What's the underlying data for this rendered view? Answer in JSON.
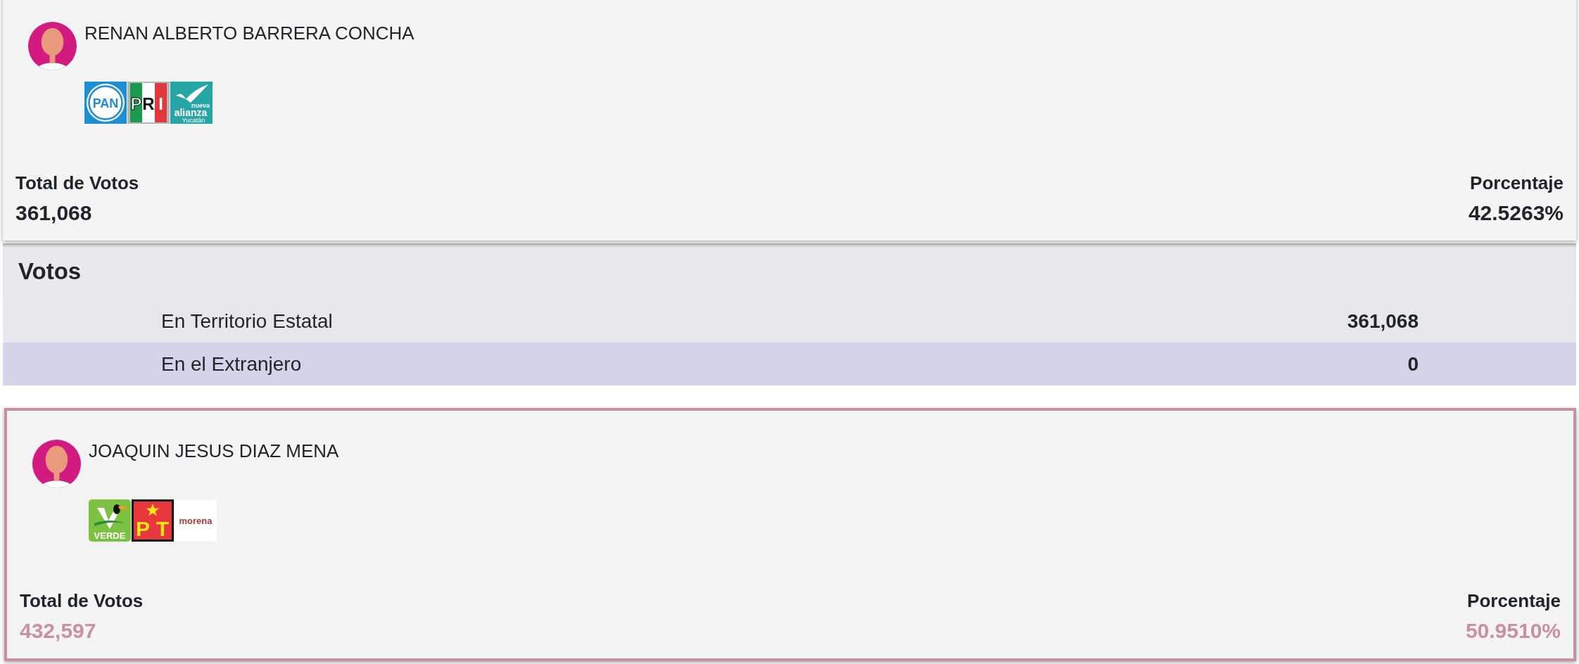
{
  "candidates": [
    {
      "name": "RENAN ALBERTO BARRERA CONCHA",
      "highlighted": false,
      "parties": [
        {
          "kind": "pan",
          "texts": [
            "PAN"
          ]
        },
        {
          "kind": "pri",
          "texts": [
            "P",
            "R",
            "I"
          ]
        },
        {
          "kind": "alianza",
          "texts": [
            "nueva",
            "alianza",
            "Yucatán"
          ]
        }
      ],
      "total": {
        "label": "Total de Votos",
        "value": "361,068"
      },
      "percentage": {
        "label": "Porcentaje",
        "value": "42.5263%"
      },
      "breakdown": {
        "title": "Votos",
        "rows": [
          {
            "label": "En Territorio Estatal",
            "value": "361,068",
            "highlighted": false
          },
          {
            "label": "En el Extranjero",
            "value": "0",
            "highlighted": true
          }
        ]
      }
    },
    {
      "name": "JOAQUIN JESUS DIAZ MENA",
      "highlighted": true,
      "parties": [
        {
          "kind": "verde",
          "texts": [
            "VERDE"
          ]
        },
        {
          "kind": "pt",
          "texts": [
            "P",
            "T"
          ]
        },
        {
          "kind": "morena",
          "texts": [
            "morena"
          ]
        }
      ],
      "total": {
        "label": "Total de Votos",
        "value": "432,597"
      },
      "percentage": {
        "label": "Porcentaje",
        "value": "50.9510%"
      }
    }
  ]
}
